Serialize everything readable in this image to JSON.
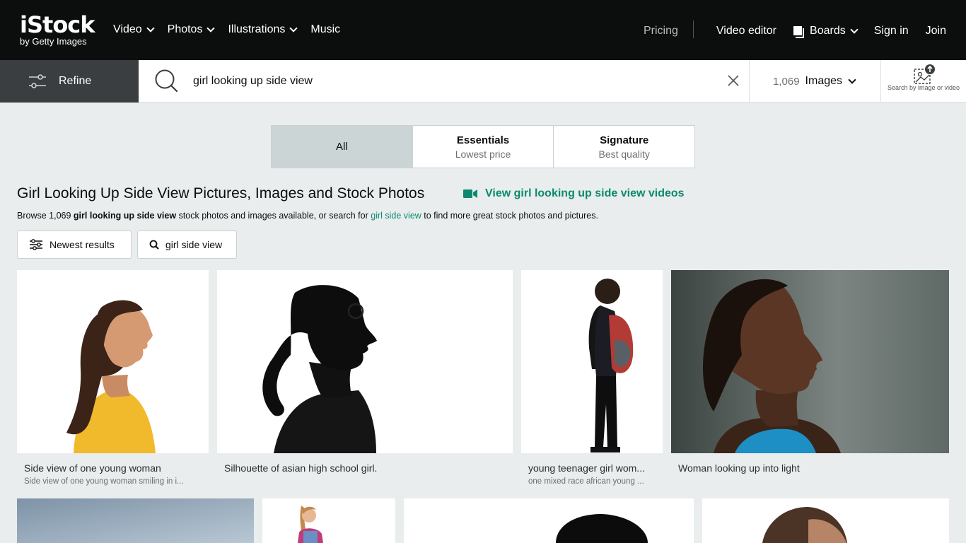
{
  "brand": {
    "name": "iStock",
    "tagline": "by Getty Images"
  },
  "nav": {
    "left": [
      {
        "label": "Video",
        "dropdown": true
      },
      {
        "label": "Photos",
        "dropdown": true
      },
      {
        "label": "Illustrations",
        "dropdown": true
      },
      {
        "label": "Music",
        "dropdown": false
      }
    ],
    "pricing": "Pricing",
    "video_editor": "Video editor",
    "boards": "Boards",
    "sign_in": "Sign in",
    "join": "Join"
  },
  "search": {
    "refine_label": "Refine",
    "query": "girl looking up side view",
    "result_count": "1,069",
    "media_type": "Images",
    "search_by_image_label": "Search by image or video"
  },
  "tabs": [
    {
      "title": "All",
      "subtitle": "",
      "active": true
    },
    {
      "title": "Essentials",
      "subtitle": "Lowest price",
      "active": false
    },
    {
      "title": "Signature",
      "subtitle": "Best quality",
      "active": false
    }
  ],
  "heading": "Girl Looking Up Side View Pictures, Images and Stock Photos",
  "video_link": "View girl looking up side view videos",
  "browse": {
    "prefix": "Browse 1,069 ",
    "term": "girl looking up side view",
    "middle": " stock photos and images available, or search for ",
    "suggestion": "girl side view",
    "suffix": " to find more great stock photos and pictures."
  },
  "chips": {
    "sort": "Newest results",
    "related": "girl side view"
  },
  "results": [
    {
      "title": "Side view of one young woman",
      "subtitle": "Side view of one young woman smiling in i..."
    },
    {
      "title": "Silhouette of asian high school girl.",
      "subtitle": ""
    },
    {
      "title": "young teenager girl wom...",
      "subtitle": "one mixed race african young ..."
    },
    {
      "title": "Woman looking up into light",
      "subtitle": ""
    }
  ],
  "colors": {
    "topbar": "#0c0d0d",
    "accent_green": "#0b8a6f",
    "refine_bg": "#3a3e40",
    "page_bg": "#e9eded",
    "active_tab": "#ccd5d6"
  }
}
